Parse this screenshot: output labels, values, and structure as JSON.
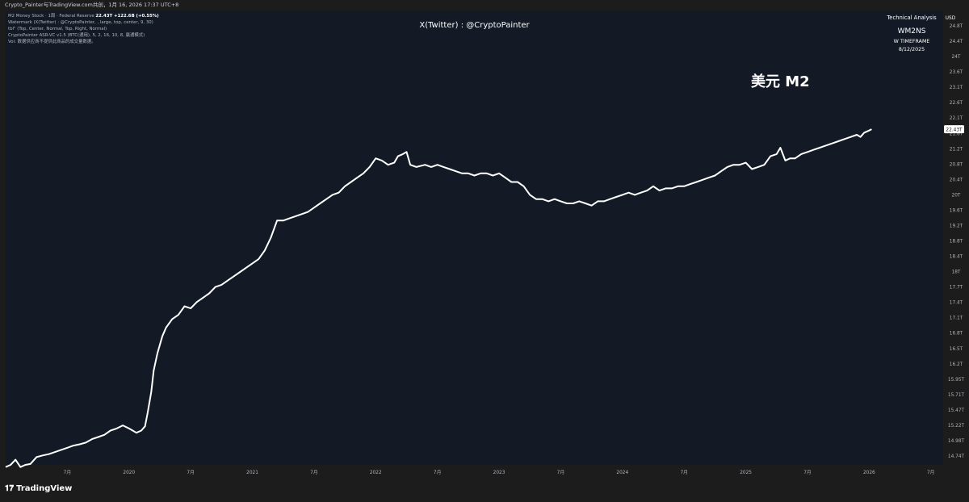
{
  "header": {
    "caption": "Crypto_Painter与TradingView.com共创，1月 16, 2026 17:37 UTC+8"
  },
  "legend": {
    "series_line": "M2 Money Stock · 1周 · Federal Reserve",
    "series_value": "22.43T +122.6B (+0.55%)",
    "line2": "Watermark (X(Twitter) : @CryptoPainter, , large, top, center, 9, 30)",
    "line3": "tbl\" (Top, Center, Normal, Top, Right, Normal)",
    "line4": "CryptoPainter ASR-VC v1.5 (BTC(通用), 5, 2, 16, 10, 8, 赢通模式)",
    "line5": "Vol: 数据供应商不提供此商品的成交量数据。"
  },
  "watermark": "X(Twitter) : @CryptoPainter",
  "panel": {
    "title": "Technical Analysis",
    "symbol": "WM2NS",
    "timeframe": "W TIMEFRAME",
    "date": "8/12/2025"
  },
  "big_title": "美元 M2",
  "logo": {
    "text": "TradingView",
    "mark": "𝟏𝟕"
  },
  "colors": {
    "plot_bg": "#131a25",
    "page_bg": "#1c1c1c",
    "line": "#ffffff",
    "axis_text": "#b2b5be"
  },
  "chart_data": {
    "type": "line",
    "currency": "USD",
    "last_value_label": "22.43T",
    "x_range": [
      2019.0,
      2026.6
    ],
    "y_range": [
      14.6,
      25.2
    ],
    "y_tick_labels": [
      "24.8T",
      "24.4T",
      "24T",
      "23.6T",
      "23.1T",
      "22.6T",
      "22.1T",
      "21.6T",
      "21.2T",
      "20.8T",
      "20.4T",
      "20T",
      "19.6T",
      "19.2T",
      "18.8T",
      "18.4T",
      "18T",
      "17.7T",
      "17.4T",
      "17.1T",
      "16.8T",
      "16.5T",
      "16.2T",
      "15.95T",
      "15.71T",
      "15.47T",
      "15.22T",
      "14.98T",
      "14.74T"
    ],
    "x_ticks": [
      {
        "t": 2019.5,
        "label": "7月"
      },
      {
        "t": 2020.0,
        "label": "2020"
      },
      {
        "t": 2020.5,
        "label": "7月"
      },
      {
        "t": 2021.0,
        "label": "2021"
      },
      {
        "t": 2021.5,
        "label": "7月"
      },
      {
        "t": 2022.0,
        "label": "2022"
      },
      {
        "t": 2022.5,
        "label": "7月"
      },
      {
        "t": 2023.0,
        "label": "2023"
      },
      {
        "t": 2023.5,
        "label": "7月"
      },
      {
        "t": 2024.0,
        "label": "2024"
      },
      {
        "t": 2024.5,
        "label": "7月"
      },
      {
        "t": 2025.0,
        "label": "2025"
      },
      {
        "t": 2025.5,
        "label": "7月"
      },
      {
        "t": 2026.0,
        "label": "2026"
      },
      {
        "t": 2026.5,
        "label": "7月"
      }
    ],
    "series": [
      {
        "points": [
          [
            2019.0,
            14.55
          ],
          [
            2019.04,
            14.6
          ],
          [
            2019.08,
            14.72
          ],
          [
            2019.12,
            14.55
          ],
          [
            2019.16,
            14.6
          ],
          [
            2019.2,
            14.62
          ],
          [
            2019.25,
            14.78
          ],
          [
            2019.3,
            14.82
          ],
          [
            2019.35,
            14.85
          ],
          [
            2019.4,
            14.9
          ],
          [
            2019.45,
            14.95
          ],
          [
            2019.5,
            15.0
          ],
          [
            2019.55,
            15.05
          ],
          [
            2019.6,
            15.08
          ],
          [
            2019.65,
            15.12
          ],
          [
            2019.7,
            15.2
          ],
          [
            2019.75,
            15.25
          ],
          [
            2019.8,
            15.3
          ],
          [
            2019.85,
            15.4
          ],
          [
            2019.9,
            15.45
          ],
          [
            2019.95,
            15.52
          ],
          [
            2020.0,
            15.45
          ],
          [
            2020.03,
            15.4
          ],
          [
            2020.06,
            15.35
          ],
          [
            2020.1,
            15.4
          ],
          [
            2020.13,
            15.5
          ],
          [
            2020.15,
            15.8
          ],
          [
            2020.18,
            16.3
          ],
          [
            2020.2,
            16.8
          ],
          [
            2020.23,
            17.2
          ],
          [
            2020.27,
            17.6
          ],
          [
            2020.3,
            17.8
          ],
          [
            2020.35,
            18.0
          ],
          [
            2020.4,
            18.1
          ],
          [
            2020.45,
            18.3
          ],
          [
            2020.5,
            18.25
          ],
          [
            2020.55,
            18.4
          ],
          [
            2020.6,
            18.5
          ],
          [
            2020.65,
            18.6
          ],
          [
            2020.7,
            18.75
          ],
          [
            2020.75,
            18.8
          ],
          [
            2020.8,
            18.9
          ],
          [
            2020.85,
            19.0
          ],
          [
            2020.9,
            19.1
          ],
          [
            2020.95,
            19.2
          ],
          [
            2021.0,
            19.3
          ],
          [
            2021.05,
            19.4
          ],
          [
            2021.1,
            19.6
          ],
          [
            2021.15,
            19.9
          ],
          [
            2021.2,
            20.3
          ],
          [
            2021.25,
            20.3
          ],
          [
            2021.3,
            20.35
          ],
          [
            2021.35,
            20.4
          ],
          [
            2021.4,
            20.45
          ],
          [
            2021.45,
            20.5
          ],
          [
            2021.5,
            20.6
          ],
          [
            2021.55,
            20.7
          ],
          [
            2021.6,
            20.8
          ],
          [
            2021.65,
            20.9
          ],
          [
            2021.7,
            20.95
          ],
          [
            2021.75,
            21.1
          ],
          [
            2021.8,
            21.2
          ],
          [
            2021.85,
            21.3
          ],
          [
            2021.9,
            21.4
          ],
          [
            2021.95,
            21.55
          ],
          [
            2022.0,
            21.75
          ],
          [
            2022.05,
            21.7
          ],
          [
            2022.1,
            21.6
          ],
          [
            2022.15,
            21.65
          ],
          [
            2022.18,
            21.8
          ],
          [
            2022.22,
            21.85
          ],
          [
            2022.25,
            21.9
          ],
          [
            2022.28,
            21.6
          ],
          [
            2022.33,
            21.55
          ],
          [
            2022.4,
            21.6
          ],
          [
            2022.45,
            21.55
          ],
          [
            2022.5,
            21.6
          ],
          [
            2022.55,
            21.55
          ],
          [
            2022.6,
            21.5
          ],
          [
            2022.65,
            21.45
          ],
          [
            2022.7,
            21.4
          ],
          [
            2022.75,
            21.4
          ],
          [
            2022.8,
            21.35
          ],
          [
            2022.85,
            21.4
          ],
          [
            2022.9,
            21.4
          ],
          [
            2022.95,
            21.35
          ],
          [
            2023.0,
            21.4
          ],
          [
            2023.05,
            21.3
          ],
          [
            2023.1,
            21.2
          ],
          [
            2023.15,
            21.2
          ],
          [
            2023.2,
            21.1
          ],
          [
            2023.25,
            20.9
          ],
          [
            2023.3,
            20.8
          ],
          [
            2023.35,
            20.8
          ],
          [
            2023.4,
            20.75
          ],
          [
            2023.45,
            20.8
          ],
          [
            2023.5,
            20.75
          ],
          [
            2023.55,
            20.7
          ],
          [
            2023.6,
            20.7
          ],
          [
            2023.65,
            20.75
          ],
          [
            2023.7,
            20.7
          ],
          [
            2023.75,
            20.65
          ],
          [
            2023.8,
            20.75
          ],
          [
            2023.85,
            20.75
          ],
          [
            2023.9,
            20.8
          ],
          [
            2023.95,
            20.85
          ],
          [
            2024.0,
            20.9
          ],
          [
            2024.05,
            20.95
          ],
          [
            2024.1,
            20.9
          ],
          [
            2024.15,
            20.95
          ],
          [
            2024.2,
            21.0
          ],
          [
            2024.25,
            21.1
          ],
          [
            2024.3,
            21.0
          ],
          [
            2024.35,
            21.05
          ],
          [
            2024.4,
            21.05
          ],
          [
            2024.45,
            21.1
          ],
          [
            2024.5,
            21.1
          ],
          [
            2024.55,
            21.15
          ],
          [
            2024.6,
            21.2
          ],
          [
            2024.65,
            21.25
          ],
          [
            2024.7,
            21.3
          ],
          [
            2024.75,
            21.35
          ],
          [
            2024.8,
            21.45
          ],
          [
            2024.85,
            21.55
          ],
          [
            2024.9,
            21.6
          ],
          [
            2024.95,
            21.6
          ],
          [
            2025.0,
            21.65
          ],
          [
            2025.05,
            21.5
          ],
          [
            2025.1,
            21.55
          ],
          [
            2025.15,
            21.6
          ],
          [
            2025.2,
            21.8
          ],
          [
            2025.25,
            21.85
          ],
          [
            2025.28,
            22.0
          ],
          [
            2025.32,
            21.7
          ],
          [
            2025.36,
            21.75
          ],
          [
            2025.4,
            21.75
          ],
          [
            2025.45,
            21.85
          ],
          [
            2025.5,
            21.9
          ],
          [
            2025.55,
            21.95
          ],
          [
            2025.6,
            22.0
          ],
          [
            2025.65,
            22.05
          ],
          [
            2025.7,
            22.1
          ],
          [
            2025.75,
            22.15
          ],
          [
            2025.8,
            22.2
          ],
          [
            2025.85,
            22.25
          ],
          [
            2025.9,
            22.3
          ],
          [
            2025.93,
            22.25
          ],
          [
            2025.96,
            22.35
          ],
          [
            2026.0,
            22.4
          ],
          [
            2026.02,
            22.43
          ]
        ]
      }
    ]
  }
}
